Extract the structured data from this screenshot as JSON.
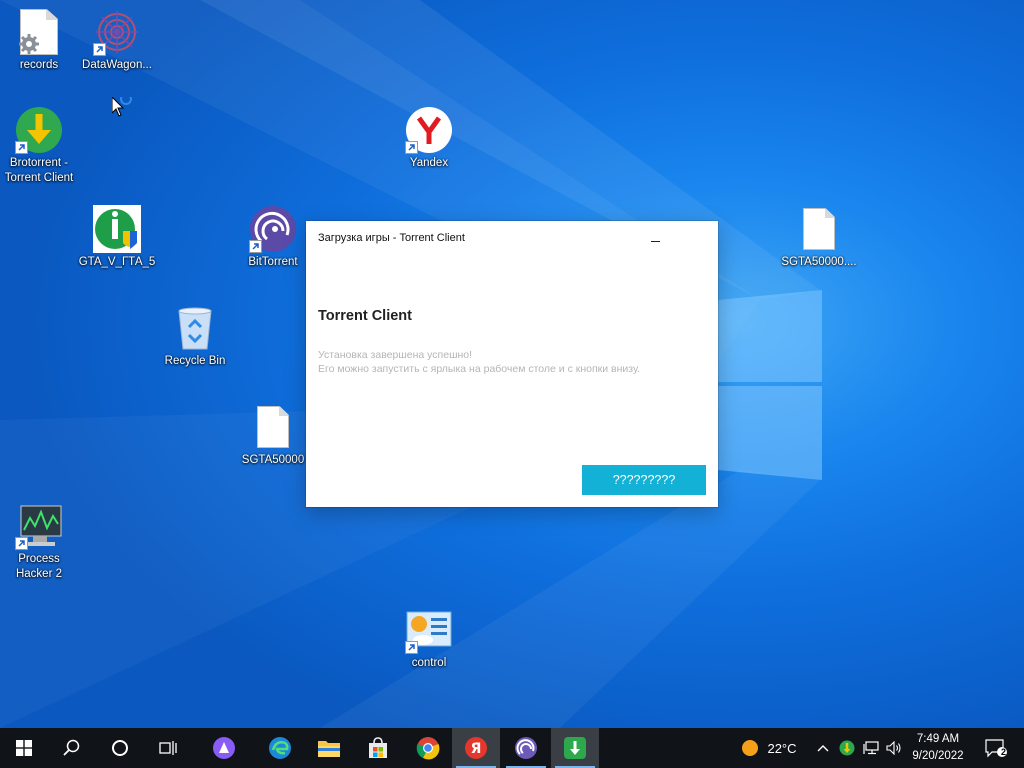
{
  "desktop": {
    "icons": {
      "records": "records",
      "datawagon": "DataWagon...",
      "brotorrent": "Brotorrent -\nTorrent Client",
      "yandex": "Yandex",
      "gta": "GTA_V_ГТА_5",
      "bittorrent": "BitTorrent",
      "sgta_right": "SGTA50000....",
      "recycle": "Recycle Bin",
      "sgta_mid": "SGTA50000",
      "process_hacker": "Process\nHacker 2",
      "control": "control"
    }
  },
  "dialog": {
    "title": "Загрузка игры - Torrent Client",
    "heading": "Torrent Client",
    "message_line1": "Установка завершена успешно!",
    "message_line2": "Его можно запустить с ярлыка на рабочем столе и с кнопки внизу.",
    "button_label": "?????????",
    "button_color": "#13b1d6"
  },
  "taskbar": {
    "weather_temp": "22°C",
    "time": "7:49 AM",
    "date": "9/20/2022",
    "notification_count": "2",
    "apps": [
      "start-icon",
      "search-icon",
      "cortana-icon",
      "task-view-icon",
      "alice-icon",
      "edge-icon",
      "file-explorer-icon",
      "store-icon",
      "chrome-icon",
      "yandex-icon",
      "bittorrent-icon",
      "torrent-client-icon"
    ]
  }
}
